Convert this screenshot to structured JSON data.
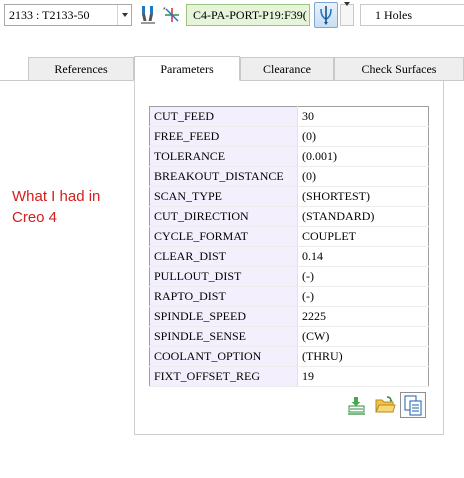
{
  "toolbar": {
    "tool_select": {
      "value": "2133 : T2133-50",
      "icon": "chevron-down-icon"
    },
    "tool_icon": "drill-tool-icon",
    "csys_icon": "coordinate-system-icon",
    "csys_value": "C4-PA-PORT-P19:F39(",
    "drill_icon": "drill-group-icon",
    "holes_value": "1 Holes"
  },
  "tabs": [
    {
      "label": "References",
      "active": false
    },
    {
      "label": "Parameters",
      "active": true
    },
    {
      "label": "Clearance",
      "active": false
    },
    {
      "label": "Check Surfaces",
      "active": false
    }
  ],
  "annotation": "What I had in Creo 4",
  "parameters": [
    {
      "name": "CUT_FEED",
      "value": "30"
    },
    {
      "name": "FREE_FEED",
      "value": "(0)"
    },
    {
      "name": "TOLERANCE",
      "value": "(0.001)"
    },
    {
      "name": "BREAKOUT_DISTANCE",
      "value": "(0)"
    },
    {
      "name": "SCAN_TYPE",
      "value": "(SHORTEST)"
    },
    {
      "name": "CUT_DIRECTION",
      "value": "(STANDARD)"
    },
    {
      "name": "CYCLE_FORMAT",
      "value": "COUPLET"
    },
    {
      "name": "CLEAR_DIST",
      "value": "0.14"
    },
    {
      "name": "PULLOUT_DIST",
      "value": "(-)"
    },
    {
      "name": "RAPTO_DIST",
      "value": "(-)"
    },
    {
      "name": "SPINDLE_SPEED",
      "value": "2225"
    },
    {
      "name": "SPINDLE_SENSE",
      "value": "(CW)"
    },
    {
      "name": "COOLANT_OPTION",
      "value": "(THRU)"
    },
    {
      "name": "FIXT_OFFSET_REG",
      "value": "19"
    }
  ],
  "bottom_icons": [
    "edit-parameters-icon",
    "open-folder-icon",
    "copy-document-icon"
  ],
  "colors": {
    "param_name_bg": "#f3effc",
    "annotation": "#d02020",
    "csys_bg": "#e6f5d9",
    "accent": "#1e78c8"
  }
}
